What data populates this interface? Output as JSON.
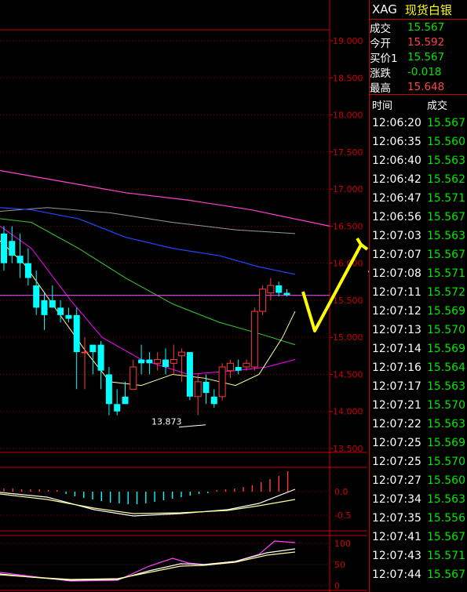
{
  "quote": {
    "symbol": "XAG",
    "name": "现货白银",
    "rows": [
      {
        "label": "成交",
        "value": "15.567",
        "color": "#00e600"
      },
      {
        "label": "今开",
        "value": "15.592",
        "color": "#ff4444"
      },
      {
        "label": "买价1",
        "value": "15.567",
        "color": "#00e600"
      },
      {
        "label": "涨跌",
        "value": "-0.018",
        "color": "#00e600"
      },
      {
        "label": "最高",
        "value": "15.648",
        "color": "#ff4444"
      }
    ]
  },
  "ticks": {
    "header_time": "时间",
    "header_price": "成交",
    "rows": [
      {
        "time": "12:06:20",
        "price": "15.567"
      },
      {
        "time": "12:06:35",
        "price": "15.560"
      },
      {
        "time": "12:06:40",
        "price": "15.563"
      },
      {
        "time": "12:06:42",
        "price": "15.562"
      },
      {
        "time": "12:06:47",
        "price": "15.571"
      },
      {
        "time": "12:06:56",
        "price": "15.567"
      },
      {
        "time": "12:07:03",
        "price": "15.563"
      },
      {
        "time": "12:07:07",
        "price": "15.567"
      },
      {
        "time": "12:07:08",
        "price": "15.571"
      },
      {
        "time": "12:07:11",
        "price": "15.572"
      },
      {
        "time": "12:07:12",
        "price": "15.569"
      },
      {
        "time": "12:07:13",
        "price": "15.570"
      },
      {
        "time": "12:07:14",
        "price": "15.569"
      },
      {
        "time": "12:07:16",
        "price": "15.564"
      },
      {
        "time": "12:07:17",
        "price": "15.563"
      },
      {
        "time": "12:07:21",
        "price": "15.570"
      },
      {
        "time": "12:07:22",
        "price": "15.563"
      },
      {
        "time": "12:07:25",
        "price": "15.569"
      },
      {
        "time": "12:07:25",
        "price": "15.570"
      },
      {
        "time": "12:07:27",
        "price": "15.560"
      },
      {
        "time": "12:07:34",
        "price": "15.563"
      },
      {
        "time": "12:07:35",
        "price": "15.556"
      },
      {
        "time": "12:07:41",
        "price": "15.567"
      },
      {
        "time": "12:07:43",
        "price": "15.571"
      },
      {
        "time": "12:07:44",
        "price": "15.567"
      }
    ]
  },
  "chart_data": {
    "type": "candlestick",
    "ylim": [
      13.5,
      19.0
    ],
    "y_ticks": [
      "19.000",
      "18.500",
      "18.000",
      "17.500",
      "17.000",
      "16.500",
      "16.000",
      "15.500",
      "15.000",
      "14.500",
      "14.000",
      "13.500"
    ],
    "low_label": "13.873",
    "candles": [
      {
        "o": 16.0,
        "h": 16.5,
        "l": 15.9,
        "c": 16.4,
        "dir": "down"
      },
      {
        "o": 16.3,
        "h": 16.5,
        "l": 16.0,
        "c": 16.1,
        "dir": "down"
      },
      {
        "o": 16.1,
        "h": 16.4,
        "l": 15.8,
        "c": 16.0,
        "dir": "down"
      },
      {
        "o": 16.0,
        "h": 16.2,
        "l": 15.7,
        "c": 15.8,
        "dir": "down"
      },
      {
        "o": 15.7,
        "h": 15.9,
        "l": 15.3,
        "c": 15.4,
        "dir": "down"
      },
      {
        "o": 15.5,
        "h": 15.6,
        "l": 15.1,
        "c": 15.3,
        "dir": "down"
      },
      {
        "o": 15.5,
        "h": 15.7,
        "l": 15.4,
        "c": 15.4,
        "dir": "down"
      },
      {
        "o": 15.4,
        "h": 15.5,
        "l": 15.2,
        "c": 15.3,
        "dir": "down"
      },
      {
        "o": 15.3,
        "h": 15.4,
        "l": 15.2,
        "c": 15.25,
        "dir": "down"
      },
      {
        "o": 15.3,
        "h": 15.4,
        "l": 14.3,
        "c": 14.8,
        "dir": "down"
      },
      {
        "o": 14.8,
        "h": 15.0,
        "l": 14.3,
        "c": 14.8,
        "dir": "up"
      },
      {
        "o": 14.9,
        "h": 14.9,
        "l": 14.5,
        "c": 14.8,
        "dir": "down"
      },
      {
        "o": 14.9,
        "h": 14.95,
        "l": 14.3,
        "c": 14.55,
        "dir": "down"
      },
      {
        "o": 14.5,
        "h": 14.6,
        "l": 13.95,
        "c": 14.1,
        "dir": "down"
      },
      {
        "o": 14.1,
        "h": 14.3,
        "l": 13.95,
        "c": 14.0,
        "dir": "down"
      },
      {
        "o": 14.1,
        "h": 14.4,
        "l": 14.1,
        "c": 14.2,
        "dir": "down"
      },
      {
        "o": 14.3,
        "h": 14.7,
        "l": 14.3,
        "c": 14.6,
        "dir": "up"
      },
      {
        "o": 14.7,
        "h": 14.9,
        "l": 14.5,
        "c": 14.65,
        "dir": "down"
      },
      {
        "o": 14.7,
        "h": 14.8,
        "l": 14.5,
        "c": 14.65,
        "dir": "down"
      },
      {
        "o": 14.65,
        "h": 14.8,
        "l": 14.55,
        "c": 14.7,
        "dir": "up"
      },
      {
        "o": 14.7,
        "h": 14.85,
        "l": 14.5,
        "c": 14.6,
        "dir": "down"
      },
      {
        "o": 14.7,
        "h": 14.9,
        "l": 14.5,
        "c": 14.65,
        "dir": "up"
      },
      {
        "o": 14.75,
        "h": 14.85,
        "l": 14.4,
        "c": 14.8,
        "dir": "up"
      },
      {
        "o": 14.8,
        "h": 14.8,
        "l": 14.15,
        "c": 14.2,
        "dir": "down"
      },
      {
        "o": 14.2,
        "h": 14.5,
        "l": 13.95,
        "c": 14.4,
        "dir": "up"
      },
      {
        "o": 14.4,
        "h": 14.5,
        "l": 14.1,
        "c": 14.25,
        "dir": "down"
      },
      {
        "o": 14.2,
        "h": 14.3,
        "l": 14.05,
        "c": 14.1,
        "dir": "down"
      },
      {
        "o": 14.2,
        "h": 14.65,
        "l": 14.15,
        "c": 14.6,
        "dir": "up"
      },
      {
        "o": 14.55,
        "h": 14.7,
        "l": 14.45,
        "c": 14.65,
        "dir": "up"
      },
      {
        "o": 14.6,
        "h": 14.7,
        "l": 14.5,
        "c": 14.55,
        "dir": "down"
      },
      {
        "o": 14.6,
        "h": 14.7,
        "l": 14.55,
        "c": 14.65,
        "dir": "up"
      },
      {
        "o": 14.6,
        "h": 15.4,
        "l": 14.55,
        "c": 15.35,
        "dir": "up"
      },
      {
        "o": 15.35,
        "h": 15.7,
        "l": 15.3,
        "c": 15.65,
        "dir": "up"
      },
      {
        "o": 15.6,
        "h": 15.8,
        "l": 15.5,
        "c": 15.7,
        "dir": "up"
      },
      {
        "o": 15.7,
        "h": 15.75,
        "l": 15.55,
        "c": 15.6,
        "dir": "down"
      },
      {
        "o": 15.6,
        "h": 15.65,
        "l": 15.55,
        "c": 15.57,
        "dir": "down"
      }
    ],
    "colors": {
      "up": "#ff3b3b",
      "down": "#00ffff",
      "ma_fast": "#ffff99",
      "ma_mid": "#ff00ff",
      "ma_green": "#33cc33",
      "ma_blue": "#2244ff",
      "ma_pink": "#ff44cc",
      "ma_gray": "#999999",
      "price_line": "#ff44ff",
      "arrow": "#ffff00"
    },
    "macd": {
      "y_ticks": [
        "0.0",
        "-0.5"
      ]
    },
    "kdj": {
      "y_ticks": [
        "100",
        "50",
        "0"
      ]
    }
  }
}
